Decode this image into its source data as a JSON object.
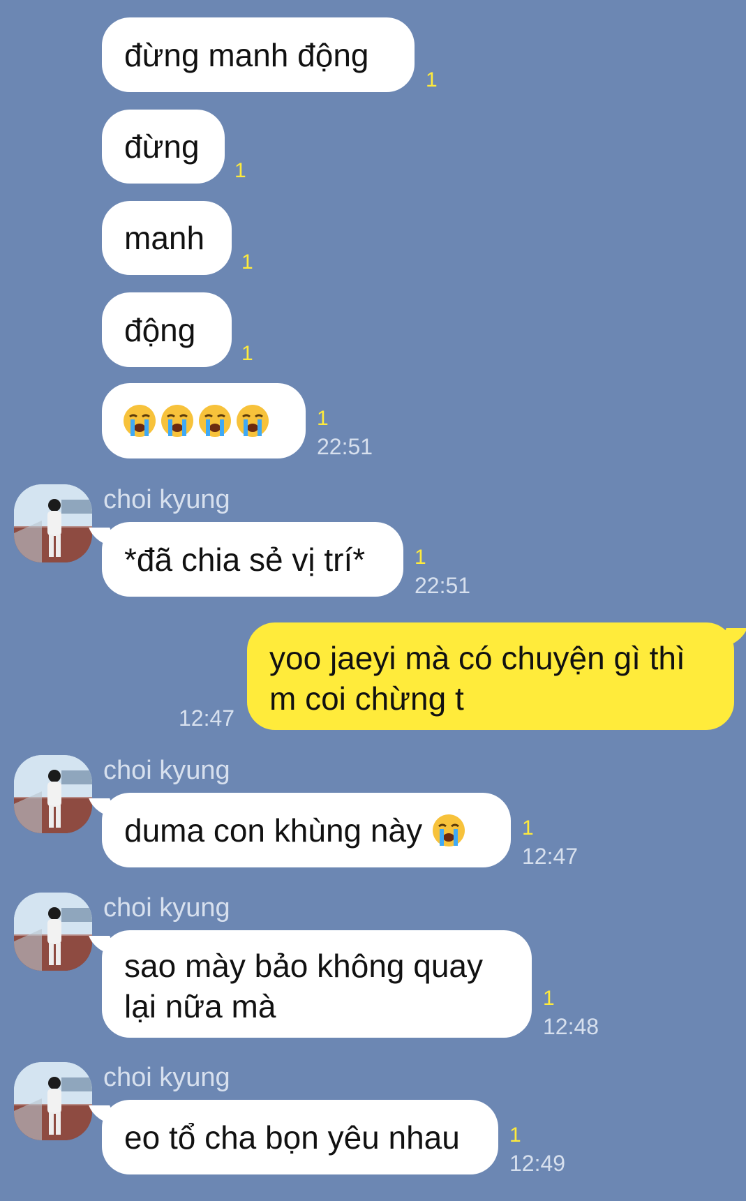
{
  "contact_name": "choi kyung",
  "colors": {
    "background": "#6c87b3",
    "incoming_bubble": "#ffffff",
    "outgoing_bubble": "#ffeb3b",
    "unread_count": "#ffeb3b",
    "meta_text": "#d7e0ee"
  },
  "messages": [
    {
      "sender": "other",
      "text": "đừng manh động",
      "unread": "1",
      "time": ""
    },
    {
      "sender": "other",
      "text": "đừng",
      "unread": "1",
      "time": ""
    },
    {
      "sender": "other",
      "text": "manh",
      "unread": "1",
      "time": ""
    },
    {
      "sender": "other",
      "text": "động",
      "unread": "1",
      "time": ""
    },
    {
      "sender": "other",
      "emoji": "loudly-crying-face-icon",
      "emoji_count": 4,
      "unread": "1",
      "time": "22:51"
    },
    {
      "sender": "choi kyung",
      "text": "*đã chia sẻ vị trí*",
      "unread": "1",
      "time": "22:51"
    },
    {
      "sender": "me",
      "text_line1": "yoo jaeyi mà có chuyện gì thì",
      "text_line2": "m coi chừng t",
      "time": "12:47"
    },
    {
      "sender": "choi kyung",
      "text": "duma con khùng này",
      "emoji": "loudly-crying-face-icon",
      "unread": "1",
      "time": "12:47"
    },
    {
      "sender": "choi kyung",
      "text_line1": "sao mày bảo không quay",
      "text_line2": "lại nữa mà",
      "unread": "1",
      "time": "12:48"
    },
    {
      "sender": "choi kyung",
      "text": "eo tổ cha bọn yêu nhau",
      "unread": "1",
      "time": "12:49"
    }
  ]
}
